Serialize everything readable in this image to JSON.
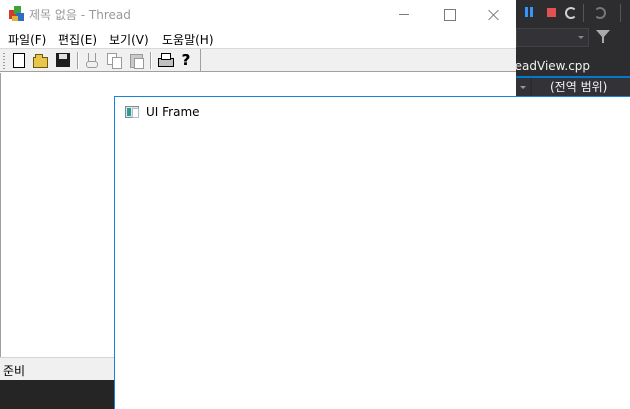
{
  "background_ide": {
    "tab_label": "readView.cpp",
    "scope_combo": "(전역 범위)",
    "accent_color": "#007acc"
  },
  "thread_window": {
    "title": "제목 없음 - Thread",
    "menu": [
      "파일(F)",
      "편집(E)",
      "보기(V)",
      "도움말(H)"
    ],
    "toolbar_icons": [
      "new-file-icon",
      "open-folder-icon",
      "save-icon",
      "cut-icon",
      "copy-icon",
      "paste-icon",
      "print-icon",
      "help-icon"
    ],
    "help_glyph": "?",
    "status_text": "준비"
  },
  "ui_frame_window": {
    "title": "UI Frame",
    "border_color": "#1883d7"
  }
}
